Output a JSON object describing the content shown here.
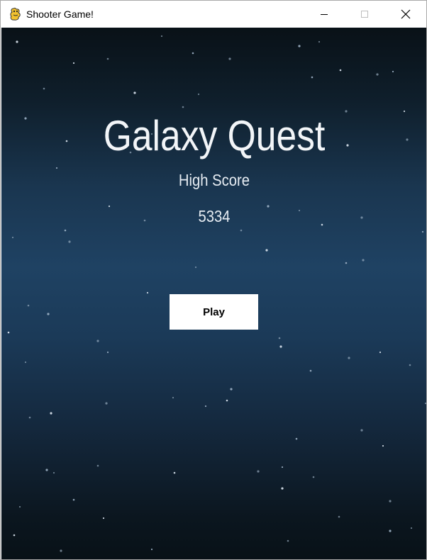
{
  "window": {
    "title": "Shooter Game!",
    "icon": "pygame-snake-icon",
    "controls": [
      "minimize-icon",
      "maximize-icon",
      "close-icon"
    ]
  },
  "game": {
    "title": "Galaxy Quest",
    "high_score_label": "High Score",
    "high_score_value": "5334",
    "play_label": "Play"
  },
  "colors": {
    "background_top": "#091117",
    "background_mid": "#1f4263",
    "background_bottom": "#081117",
    "text": "#f2f5f8",
    "button_bg": "#ffffff",
    "button_text": "#000000"
  }
}
